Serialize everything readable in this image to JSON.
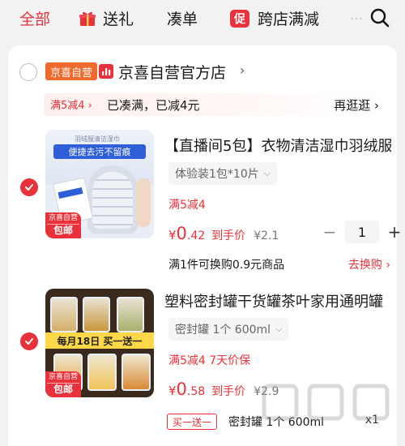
{
  "tabs": {
    "all": "全部",
    "gift": "送礼",
    "couqi": "凑单",
    "kua_badge": "促",
    "kua": "跨店满减",
    "more": "…"
  },
  "store": {
    "badge": "京喜自营",
    "name": "京喜自营官方店",
    "chevron": "›"
  },
  "promo": {
    "tag": "满5减4 ›",
    "text": "已凑满，已减4元",
    "more": "再逛逛 ›"
  },
  "items": [
    {
      "title": "【直播间5包】衣物清洁湿巾羽绒服",
      "spec": "体验装1包*10片",
      "tags": "满5减4",
      "price_int": "0",
      "price_dec": ".42",
      "price_label": "到手价",
      "orig_price": "¥2.1",
      "qty": "1",
      "exchange_text": "满1件可换购0.9元商品",
      "exchange_link": "去换购 ›",
      "thumb_badge_top": "京喜自营",
      "thumb_badge_bottom": "包邮",
      "thumb_caption_top": "羽绒服清洁湿巾",
      "thumb_caption_main": "便捷去污不留痕"
    },
    {
      "title": "塑料密封罐干货罐茶叶家用通明罐",
      "spec": "密封罐 1个 600ml",
      "tags": "满5减4  7天价保",
      "price_int": "0",
      "price_dec": ".58",
      "price_label": "到手价",
      "orig_price": "¥2.9",
      "gift_tag": "买一送一",
      "gift_spec": "密封罐 1个 600ml",
      "gift_qty": "x1",
      "thumb_badge_top": "京喜自营",
      "thumb_badge_bottom": "包邮",
      "thumb_banner": "每月18日 买一送一"
    }
  ],
  "colors": {
    "accent": "#e8313a",
    "store_badge": "#f06a2b",
    "page_bg": "#f2f2f2"
  },
  "icons": [
    "gift-icon",
    "promo-badge-icon",
    "search-icon",
    "store-chart-icon",
    "check-icon",
    "chevron-down-icon"
  ]
}
